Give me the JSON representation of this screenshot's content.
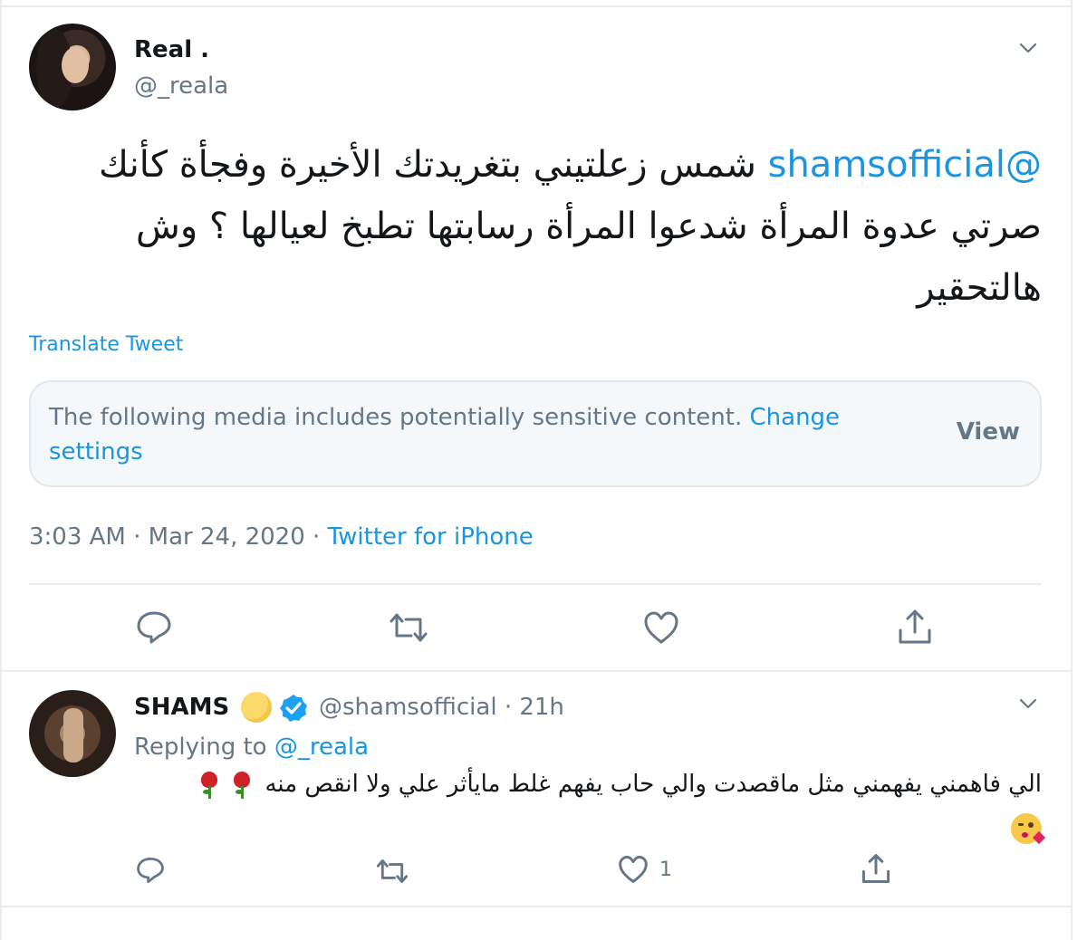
{
  "main_tweet": {
    "display_name": "Real .",
    "handle": "@_reala",
    "mention": "@shamsofficial",
    "text_after_mention": " شمس زعلتيني بتغريدتك الأخيرة وفجأة كأنك صرتي عدوة المرأة شدعوا المرأة رسابتها تطبخ لعيالها ؟ وش هالتحقير",
    "translate_label": "Translate Tweet",
    "sensitive_notice": "The following media includes potentially sensitive content.",
    "change_settings_label": "Change settings",
    "view_label": "View",
    "timestamp": "3:03 AM · Mar 24, 2020 · ",
    "source": "Twitter for iPhone",
    "actions": [
      "reply-icon",
      "retweet-icon",
      "like-icon",
      "share-icon"
    ]
  },
  "reply": {
    "display_name": "SHAMS",
    "handle_time": "@shamsofficial · 21h",
    "replying_prefix": "Replying to ",
    "replying_to": "@_reala",
    "text": "الي فاهمني يفهمني مثل ماقصدت والي حاب يفهم غلط مايأثر علي ولا انقص منه",
    "emojis": [
      "rose-emoji",
      "rose-emoji",
      "kissing-face-emoji"
    ],
    "like_count": "1",
    "actions": [
      "reply-icon",
      "retweet-icon",
      "like-icon",
      "share-icon"
    ]
  },
  "colors": {
    "link_blue": "#1b95e0",
    "secondary_gray": "#657786",
    "border": "#e6ecf0",
    "verified_blue": "#1da1f2"
  }
}
